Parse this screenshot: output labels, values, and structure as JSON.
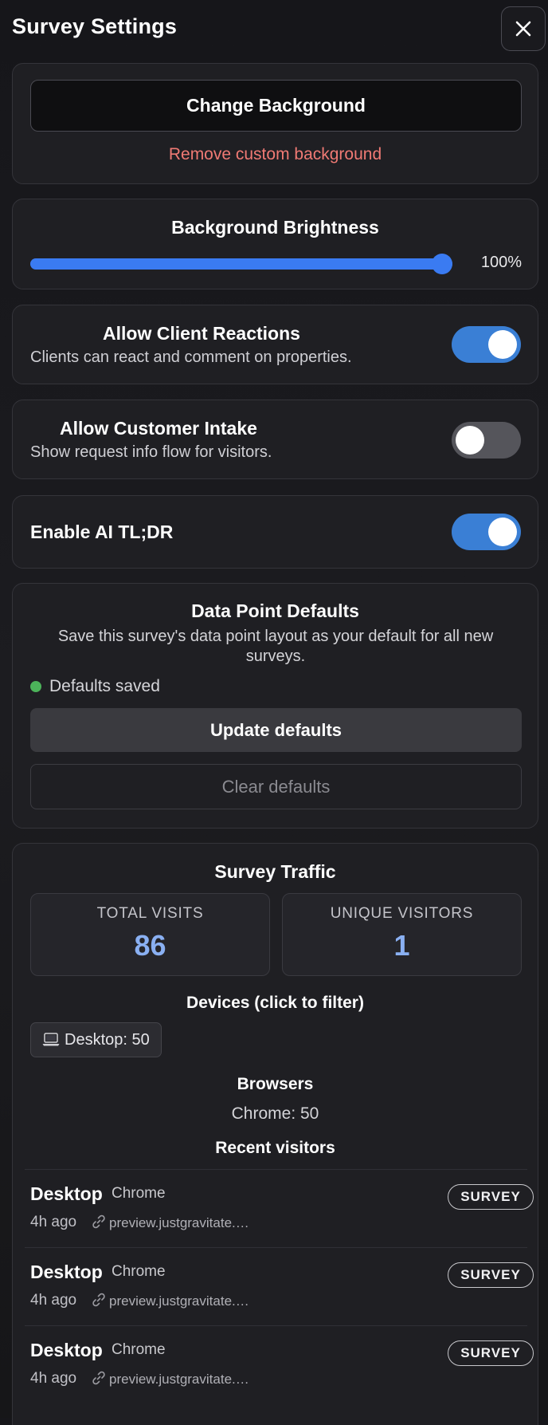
{
  "header": {
    "title": "Survey Settings"
  },
  "background": {
    "change_label": "Change Background",
    "remove_label": "Remove custom background"
  },
  "brightness": {
    "title": "Background Brightness",
    "value": 100,
    "value_label": "100%"
  },
  "client_reactions": {
    "title": "Allow Client Reactions",
    "description": "Clients can react and comment on properties.",
    "enabled": true
  },
  "customer_intake": {
    "title": "Allow Customer Intake",
    "description": "Show request info flow for visitors.",
    "enabled": false
  },
  "ai_tldr": {
    "title": "Enable AI TL;DR",
    "enabled": true
  },
  "data_point_defaults": {
    "title": "Data Point Defaults",
    "description_line1": "Save this survey's data point layout as your default for all new",
    "description_line2": "surveys.",
    "status": "Defaults saved",
    "update_label": "Update defaults",
    "clear_label": "Clear defaults"
  },
  "traffic": {
    "title": "Survey Traffic",
    "total_visits_label": "TOTAL VISITS",
    "total_visits": "86",
    "unique_visitors_label": "UNIQUE VISITORS",
    "unique_visitors": "1",
    "devices_label": "Devices (click to filter)",
    "device_chip": "Desktop: 50",
    "browsers_label": "Browsers",
    "browsers_value": "Chrome: 50",
    "recent_label": "Recent visitors",
    "visitors": [
      {
        "device": "Desktop",
        "browser": "Chrome",
        "time": "4h ago",
        "url": "preview.justgravitate.…",
        "badge": "SURVEY"
      },
      {
        "device": "Desktop",
        "browser": "Chrome",
        "time": "4h ago",
        "url": "preview.justgravitate.…",
        "badge": "SURVEY"
      },
      {
        "device": "Desktop",
        "browser": "Chrome",
        "time": "4h ago",
        "url": "preview.justgravitate.…",
        "badge": "SURVEY"
      }
    ]
  },
  "colors": {
    "accent": "#3a7bf2",
    "toggle_on": "#3a7fd5",
    "danger_text": "#f07a74",
    "success_dot": "#4cb35a",
    "stat_value": "#8ab0f2"
  },
  "icons": {
    "close": "close-icon",
    "laptop": "laptop-icon",
    "link": "link-icon"
  }
}
